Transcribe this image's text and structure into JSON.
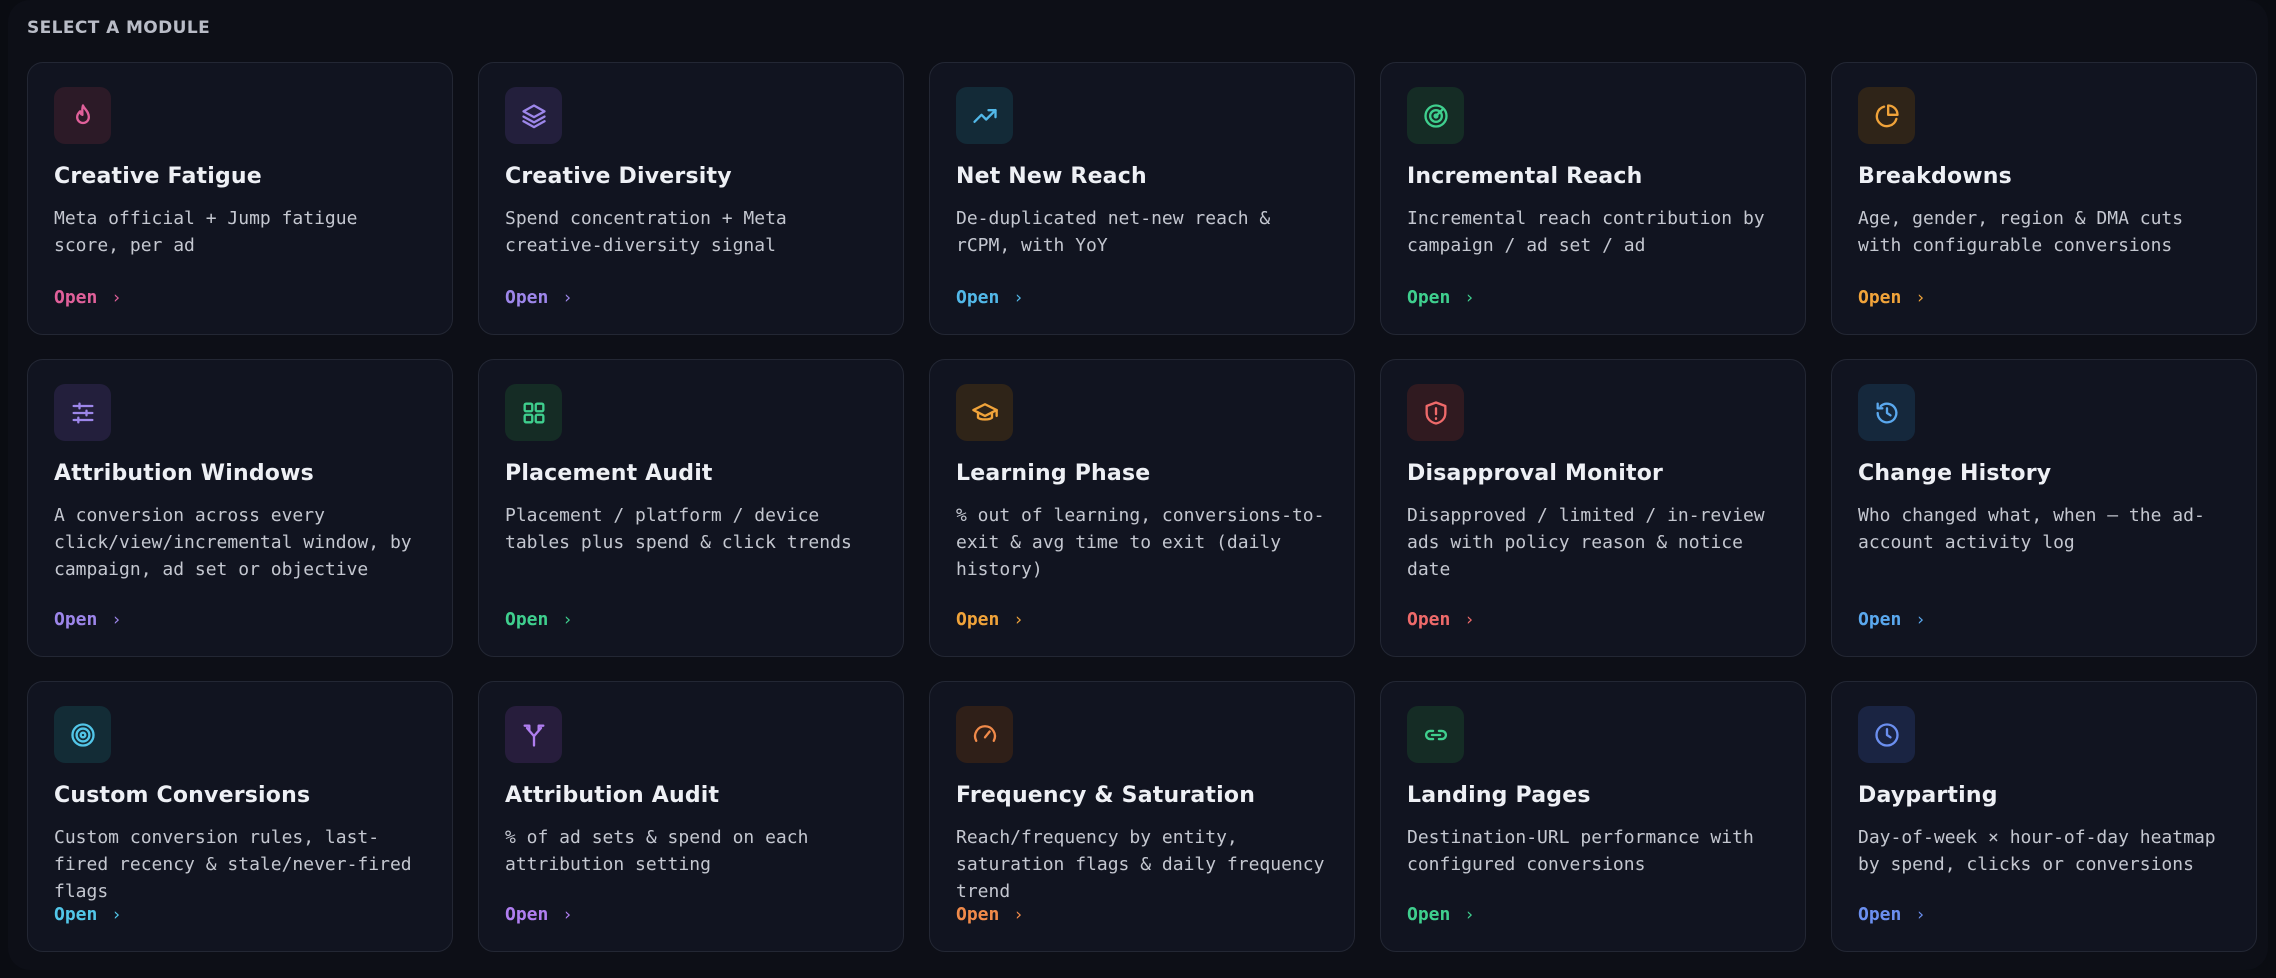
{
  "heading": "SELECT A MODULE",
  "open_label": "Open",
  "modules": [
    {
      "title": "Creative Fatigue",
      "desc": "Meta official + Jump fatigue score, per ad",
      "icon": "flame-icon",
      "color": "#e0609a",
      "tile": "#2c1a27"
    },
    {
      "title": "Creative Diversity",
      "desc": "Spend concentration + Meta creative-diversity signal",
      "icon": "layers-icon",
      "color": "#9d86ea",
      "tile": "#231f3c"
    },
    {
      "title": "Net New Reach",
      "desc": "De-duplicated net-new reach & rCPM, with YoY",
      "icon": "trending-up-icon",
      "color": "#52b8e8",
      "tile": "#132a37"
    },
    {
      "title": "Incremental Reach",
      "desc": "Incremental reach contribution by campaign / ad set / ad",
      "icon": "radar-icon",
      "color": "#3fcf8e",
      "tile": "#152c25"
    },
    {
      "title": "Breakdowns",
      "desc": "Age, gender, region & DMA cuts with configurable conversions",
      "icon": "pie-chart-icon",
      "color": "#f0a33a",
      "tile": "#2f2418"
    },
    {
      "title": "Attribution Windows",
      "desc": "A conversion across every click/view/incremental window, by campaign, ad set or objective",
      "icon": "sliders-icon",
      "color": "#9d86ea",
      "tile": "#231f3c"
    },
    {
      "title": "Placement Audit",
      "desc": "Placement / platform / device tables plus spend & click trends",
      "icon": "grid-icon",
      "color": "#3fcf8e",
      "tile": "#152c25"
    },
    {
      "title": "Learning Phase",
      "desc": "% out of learning, conversions-to-exit & avg time to exit (daily history)",
      "icon": "graduation-cap-icon",
      "color": "#f0a33a",
      "tile": "#2f2418"
    },
    {
      "title": "Disapproval Monitor",
      "desc": "Disapproved / limited / in-review ads with policy reason & notice date",
      "icon": "shield-alert-icon",
      "color": "#ee6a6a",
      "tile": "#301a20"
    },
    {
      "title": "Change History",
      "desc": "Who changed what, when — the ad-account activity log",
      "icon": "history-icon",
      "color": "#5aa8ee",
      "tile": "#15283c"
    },
    {
      "title": "Custom Conversions",
      "desc": "Custom conversion rules, last-fired recency & stale/never-fired flags",
      "icon": "target-icon",
      "color": "#52c6e8",
      "tile": "#132c36"
    },
    {
      "title": "Attribution Audit",
      "desc": "% of ad sets & spend on each attribution setting",
      "icon": "split-icon",
      "color": "#b07ef0",
      "tile": "#271d3c"
    },
    {
      "title": "Frequency & Saturation",
      "desc": "Reach/frequency by entity, saturation flags & daily frequency trend",
      "icon": "gauge-icon",
      "color": "#f08a4a",
      "tile": "#2f1f18"
    },
    {
      "title": "Landing Pages",
      "desc": "Destination-URL performance with configured conversions",
      "icon": "link-icon",
      "color": "#3fcf8e",
      "tile": "#152c25"
    },
    {
      "title": "Dayparting",
      "desc": "Day-of-week × hour-of-day heatmap by spend, clicks or conversions",
      "icon": "clock-icon",
      "color": "#6b8fef",
      "tile": "#1a2442"
    }
  ]
}
